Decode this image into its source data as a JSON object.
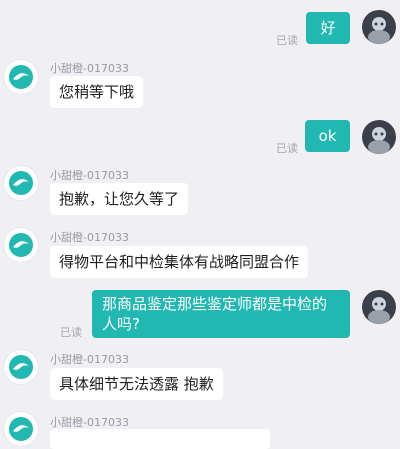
{
  "agent_name": "小甜橙-017033",
  "read_label": "已读",
  "messages": [
    {
      "from": "user",
      "text": "好"
    },
    {
      "from": "agent",
      "text": "您稍等下哦"
    },
    {
      "from": "user",
      "text": "ok"
    },
    {
      "from": "agent",
      "text": "抱歉，让您久等了"
    },
    {
      "from": "agent",
      "text": "得物平台和中检集体有战略同盟合作"
    },
    {
      "from": "user",
      "text": "那商品鉴定那些鉴定师都是中检的人吗?"
    },
    {
      "from": "agent",
      "text": "具体细节无法透露 抱歉"
    },
    {
      "from": "agent",
      "text": ""
    }
  ],
  "colors": {
    "outgoing_bubble": "#20b8b0",
    "background": "#f0eff3",
    "incoming_bubble": "#ffffff"
  }
}
